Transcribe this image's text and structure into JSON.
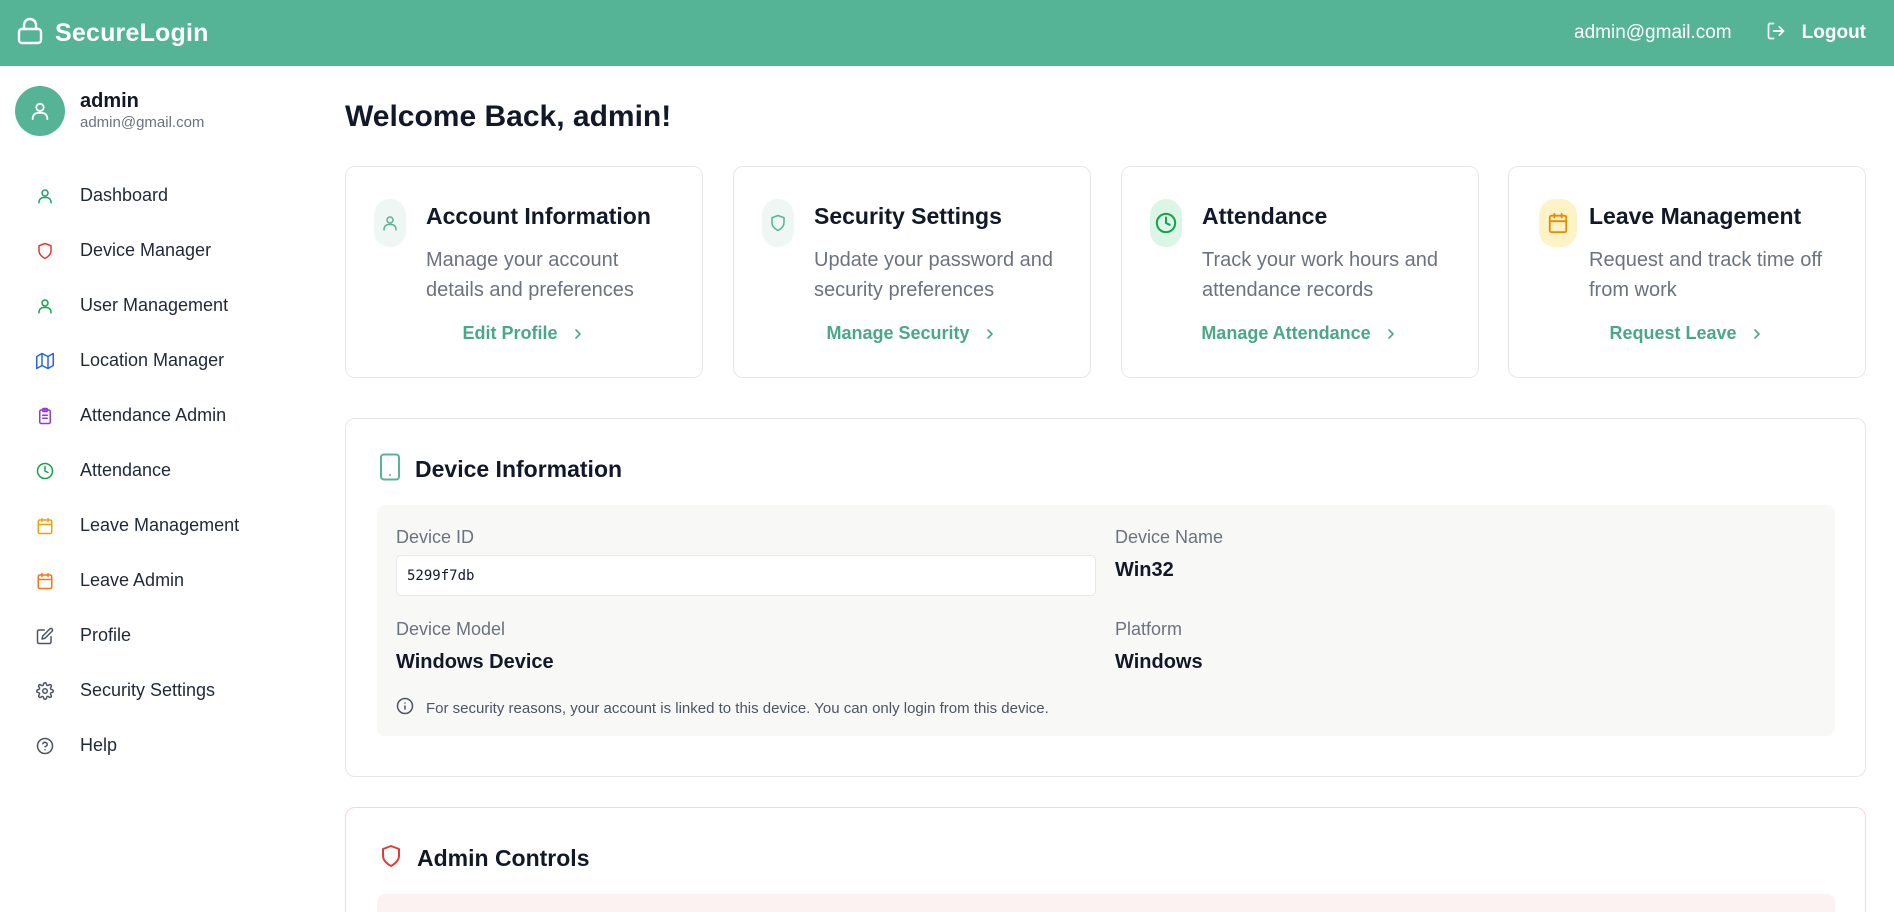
{
  "app": {
    "brand": "SecureLogin",
    "user_email": "admin@gmail.com",
    "logout_label": "Logout"
  },
  "sidebar": {
    "user": {
      "name": "admin",
      "email": "admin@gmail.com"
    },
    "items": [
      {
        "label": "Dashboard",
        "icon": "user-icon",
        "color": "#22a06b"
      },
      {
        "label": "Device Manager",
        "icon": "shield-icon",
        "color": "#e53935"
      },
      {
        "label": "User Management",
        "icon": "user-icon",
        "color": "#16a34a"
      },
      {
        "label": "Location Manager",
        "icon": "map-icon",
        "color": "#2563eb"
      },
      {
        "label": "Attendance Admin",
        "icon": "clipboard-icon",
        "color": "#9333ea"
      },
      {
        "label": "Attendance",
        "icon": "clock-icon",
        "color": "#16a34a"
      },
      {
        "label": "Leave Management",
        "icon": "calendar-icon",
        "color": "#f59e0b"
      },
      {
        "label": "Leave Admin",
        "icon": "calendar-icon",
        "color": "#f97316"
      },
      {
        "label": "Profile",
        "icon": "edit-icon",
        "color": "#4b5563"
      },
      {
        "label": "Security Settings",
        "icon": "gear-icon",
        "color": "#4b5563"
      },
      {
        "label": "Help",
        "icon": "help-circle-icon",
        "color": "#4b5563"
      }
    ]
  },
  "main": {
    "welcome": "Welcome Back, admin!",
    "cards": [
      {
        "title": "Account Information",
        "description": "Manage your account details and preferences",
        "link": "Edit Profile",
        "icon": "user-icon",
        "icon_color": "#55b495",
        "bg": "#eef7f3"
      },
      {
        "title": "Security Settings",
        "description": "Update your password and security preferences",
        "link": "Manage Security",
        "icon": "shield-icon",
        "icon_color": "#55b495",
        "bg": "#eef7f3"
      },
      {
        "title": "Attendance",
        "description": "Track your work hours and attendance records",
        "link": "Manage Attendance",
        "icon": "clock-icon",
        "icon_color": "#16a34a",
        "bg": "#dcf5e7"
      },
      {
        "title": "Leave Management",
        "description": "Request and track time off from work",
        "link": "Request Leave",
        "icon": "calendar-icon",
        "icon_color": "#ea8a00",
        "bg": "#fef3c7"
      }
    ],
    "device": {
      "title": "Device Information",
      "device_id_label": "Device ID",
      "device_id": "5299f7db",
      "device_name_label": "Device Name",
      "device_name": "Win32",
      "device_model_label": "Device Model",
      "device_model": "Windows Device",
      "platform_label": "Platform",
      "platform": "Windows",
      "notice": "For security reasons, your account is linked to this device. You can only login from this device."
    },
    "admin": {
      "title": "Admin Controls"
    }
  }
}
